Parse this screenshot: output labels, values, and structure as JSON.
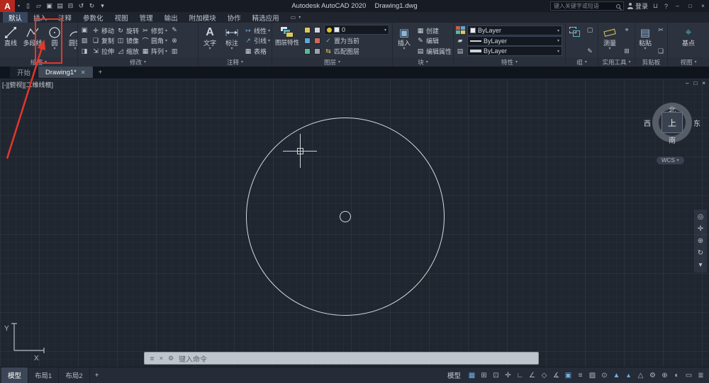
{
  "titlebar": {
    "logo_letter": "A",
    "app_title": "Autodesk AutoCAD 2020",
    "doc_title": "Drawing1.dwg",
    "search_placeholder": "键入关键字或短语",
    "signin_label": "登录",
    "qat": [
      {
        "name": "new-file",
        "glyph": "▯"
      },
      {
        "name": "open-file",
        "glyph": "▱"
      },
      {
        "name": "save",
        "glyph": "▣"
      },
      {
        "name": "save-as",
        "glyph": "▤"
      },
      {
        "name": "plot",
        "glyph": "⊟"
      },
      {
        "name": "undo",
        "glyph": "↺"
      },
      {
        "name": "redo",
        "glyph": "↻"
      },
      {
        "name": "qat-more",
        "glyph": "▾"
      }
    ]
  },
  "ribbon_tabs": {
    "items": [
      {
        "label": "默认"
      },
      {
        "label": "插入"
      },
      {
        "label": "注释"
      },
      {
        "label": "参数化"
      },
      {
        "label": "视图"
      },
      {
        "label": "管理"
      },
      {
        "label": "输出"
      },
      {
        "label": "附加模块"
      },
      {
        "label": "协作"
      },
      {
        "label": "精选应用"
      }
    ]
  },
  "panels": {
    "draw": {
      "title": "绘图",
      "tools": [
        {
          "label": "直线"
        },
        {
          "label": "多段线"
        },
        {
          "label": "圆"
        },
        {
          "label": "圆弧"
        }
      ]
    },
    "modify": {
      "title": "修改",
      "grid": [
        [
          "移动",
          "旋转",
          "修剪"
        ],
        [
          "复制",
          "镜像",
          "圆角"
        ],
        [
          "拉伸",
          "缩放",
          "阵列"
        ]
      ]
    },
    "annotate": {
      "title": "注释",
      "text": "文字",
      "dim": "标注",
      "linear": "线性",
      "leader": "引线",
      "table": "表格"
    },
    "layers": {
      "title": "图层",
      "properties_label": "图层特性",
      "current_layer": "0",
      "make_current": "置为当前",
      "match_layer": "匹配图层"
    },
    "block": {
      "title": "块",
      "insert": "插入",
      "create": "创建",
      "edit": "编辑",
      "edit_attrs": "编辑属性"
    },
    "properties": {
      "title": "特性",
      "color_value": "ByLayer",
      "linetype_value": "ByLayer",
      "lineweight_value": "ByLayer"
    },
    "group": {
      "title": "组"
    },
    "utilities": {
      "title": "实用工具",
      "measure": "测量"
    },
    "clipboard": {
      "title": "剪贴板",
      "paste": "粘贴"
    },
    "view": {
      "title": "视图",
      "base": "基点"
    }
  },
  "filetabs": {
    "start": "开始",
    "active_doc": "Drawing1*",
    "add_label": "+"
  },
  "canvas": {
    "viewport_label": "[-][俯视][二维线框]",
    "viewcube": {
      "north": "北",
      "south": "南",
      "west": "西",
      "east": "东",
      "top": "上",
      "wcs": "WCS"
    },
    "ucs_x": "X",
    "ucs_y": "Y",
    "command_placeholder": "键入命令"
  },
  "statusbar": {
    "tabs": [
      {
        "label": "模型"
      },
      {
        "label": "布局1"
      },
      {
        "label": "布局2"
      }
    ],
    "add_tab": "+",
    "model_label": "模型",
    "icons": [
      {
        "name": "grid",
        "glyph": "▦",
        "active": true
      },
      {
        "name": "snap",
        "glyph": "⊞",
        "active": false
      },
      {
        "name": "infer-constraints",
        "glyph": "⊡",
        "active": false
      },
      {
        "name": "dynamic-input",
        "glyph": "✛",
        "active": false
      },
      {
        "name": "ortho",
        "glyph": "∟",
        "active": false
      },
      {
        "name": "polar-tracking",
        "glyph": "∠",
        "active": false
      },
      {
        "name": "isodraft",
        "glyph": "◇",
        "active": false
      },
      {
        "name": "osnap-tracking",
        "glyph": "∡",
        "active": false
      },
      {
        "name": "osnap",
        "glyph": "▣",
        "active": true
      },
      {
        "name": "lineweight",
        "glyph": "≡",
        "active": false
      },
      {
        "name": "transparency",
        "glyph": "▨",
        "active": false
      },
      {
        "name": "selection-cycling",
        "glyph": "⊙",
        "active": false
      },
      {
        "name": "annotation-visibility",
        "glyph": "▲",
        "active": true
      },
      {
        "name": "annotation-autoscale",
        "glyph": "▴",
        "active": true
      },
      {
        "name": "annotation-scale",
        "glyph": "△",
        "active": false
      },
      {
        "name": "workspace-switching",
        "glyph": "⚙",
        "active": false
      },
      {
        "name": "annotation-monitor",
        "glyph": "⊕",
        "active": false
      },
      {
        "name": "isolate-objects",
        "glyph": "◐",
        "active": false
      },
      {
        "name": "clean-screen",
        "glyph": "▭",
        "active": false
      },
      {
        "name": "customize",
        "glyph": "≣",
        "active": false
      }
    ]
  },
  "glyphs": {
    "dropdown": "▾",
    "close": "✕",
    "window_close": "×",
    "minimize": "‒",
    "restore": "□",
    "cart": "⊔",
    "help": "?",
    "panel_box": "▭",
    "grip": "≣",
    "wrench": "⚙"
  },
  "icons": {
    "move": "✛",
    "copy": "❏",
    "stretch": "⇲",
    "rotate": "↻",
    "mirror": "◫",
    "scale": "◿",
    "trim": "✂",
    "fillet": "⌒",
    "array": "▦",
    "erase": "✎",
    "explode": "⊗",
    "fade": "▥",
    "extra1": "▣",
    "extra2": "▨",
    "extra3": "◨",
    "text": "A",
    "linear": "↦",
    "leader": "↗",
    "table": "▦",
    "insert": "▣",
    "create": "▦",
    "edit": "✎",
    "edit_attrs": "▤",
    "brush": "▰",
    "paste": "▤",
    "cut": "✂",
    "base": "⌖",
    "make_current": "✓",
    "match_layer": "⇆",
    "group_b": "▢",
    "util_id": "⌖",
    "util_calc": "⊞",
    "nav_wheel": "◎",
    "nav_pan": "✛",
    "nav_zoom": "⊕",
    "nav_orbit": "↻",
    "nav_more": "▾"
  },
  "colors": {
    "highlight_red": "#e2372c",
    "titlebar_bg": "#161b24",
    "ribbon_bg": "#2d333e",
    "canvas_bg": "#20262f",
    "grid_line": "#2a323e",
    "circle_stroke": "#d5d9de",
    "active_icon_blue": "#6fb0e8",
    "logo_red": "#b5281e"
  }
}
